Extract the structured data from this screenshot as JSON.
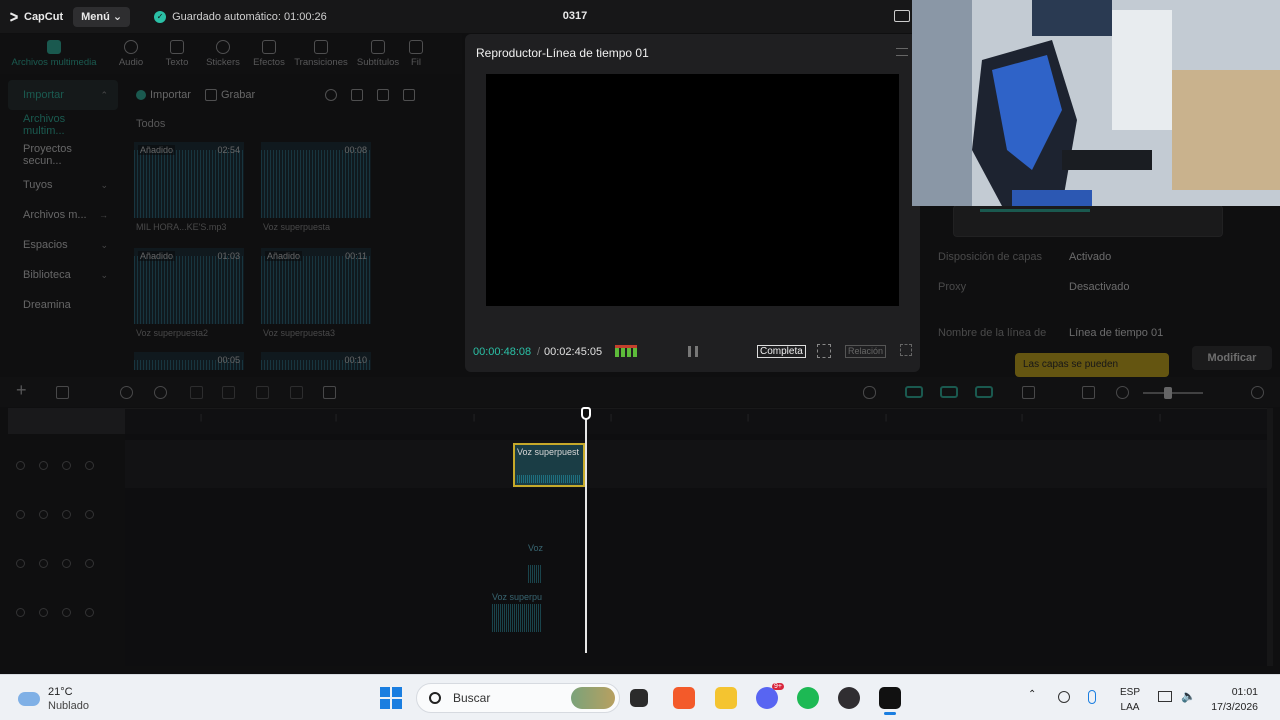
{
  "titlebar": {
    "app_name": "CapCut",
    "menu_label": "Menú",
    "autosave_text": "Guardado automático: 01:00:26",
    "project_name": "0317"
  },
  "toolstrip": {
    "tools": [
      {
        "label": "Archivos multimedia",
        "icon": "media-icon",
        "active": true
      },
      {
        "label": "Audio",
        "icon": "audio-icon"
      },
      {
        "label": "Texto",
        "icon": "text-icon"
      },
      {
        "label": "Stickers",
        "icon": "sticker-icon"
      },
      {
        "label": "Efectos",
        "icon": "effects-icon"
      },
      {
        "label": "Transiciones",
        "icon": "transitions-icon"
      },
      {
        "label": "Subtítulos",
        "icon": "subtitles-icon"
      },
      {
        "label": "Fil",
        "icon": "filter-icon"
      }
    ]
  },
  "sidebar": {
    "items": [
      {
        "label": "Importar",
        "expandable": true,
        "state": "active"
      },
      {
        "label": "Archivos multim...",
        "state": "selected"
      },
      {
        "label": "Proyectos secun..."
      },
      {
        "label": "Tuyos",
        "expandable": true
      },
      {
        "label": "Archivos m...",
        "expandable": true
      },
      {
        "label": "Espacios",
        "expandable": true
      },
      {
        "label": "Biblioteca",
        "expandable": true
      },
      {
        "label": "Dreamina"
      }
    ]
  },
  "media": {
    "import_label": "Importar",
    "record_label": "Grabar",
    "section_title": "Todos",
    "items": [
      {
        "name": "MIL HORA...KE'S.mp3",
        "duration": "02:54",
        "tag": "Añadido"
      },
      {
        "name": "Voz superpuesta",
        "duration": "00:08",
        "tag": ""
      },
      {
        "name": "Voz superpuesta2",
        "duration": "01:03",
        "tag": "Añadido"
      },
      {
        "name": "Voz superpuesta3",
        "duration": "00:11",
        "tag": "Añadido"
      },
      {
        "name": "",
        "duration": "00:05",
        "tag": ""
      },
      {
        "name": "",
        "duration": "00:10",
        "tag": ""
      }
    ]
  },
  "player": {
    "title": "Reproductor-Línea de tiempo 01",
    "current_time": "00:00:48:08",
    "separator": "/",
    "total_time": "00:02:45:05",
    "fit_label": "Completa",
    "ratio_label": "Relación"
  },
  "details": {
    "rows": [
      {
        "key": "Disposición de capas",
        "value": "Activado"
      },
      {
        "key": "Proxy",
        "value": "Desactivado"
      },
      {
        "key": "Nombre de la línea de",
        "value": "Línea de tiempo 01"
      }
    ],
    "warning_text": "Las capas se pueden",
    "modify_label": "Modificar"
  },
  "timeline": {
    "clip_label": "Voz superpuest",
    "ghost_labels": [
      "Voz",
      "Voz superpu"
    ]
  },
  "taskbar": {
    "temperature": "21°C",
    "weather": "Nublado",
    "search_placeholder": "Buscar",
    "language": "ESP",
    "layout": "LAA",
    "time": "01:01",
    "date": "17/3/2026",
    "discord_badge": "9+"
  },
  "colors": {
    "accent": "#2bc0a6",
    "warning": "#d9b514",
    "clip_border": "#c6a92a"
  }
}
